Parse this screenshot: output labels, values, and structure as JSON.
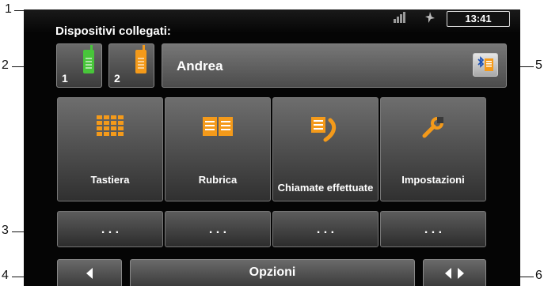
{
  "callouts": [
    "1",
    "2",
    "3",
    "4",
    "5",
    "6"
  ],
  "status": {
    "clock": "13:41",
    "signal_icon": "signal-icon",
    "gps_icon": "gps-satellite-icon"
  },
  "devices": {
    "label": "Dispositivi collegati:",
    "items": [
      {
        "number": "1",
        "icon": "phone-icon",
        "color": "#48c63a"
      },
      {
        "number": "2",
        "icon": "phone-icon",
        "color": "#f49a1a"
      }
    ]
  },
  "contact": {
    "name": "Andrea",
    "bluetooth_icon": "bluetooth-phonebook-icon"
  },
  "tiles": [
    {
      "label": "Tastiera",
      "icon": "keypad-icon"
    },
    {
      "label": "Rubrica",
      "icon": "phonebook-icon"
    },
    {
      "label": "Chiamate effettuate",
      "icon": "outgoing-calls-icon"
    },
    {
      "label": "Impostazioni",
      "icon": "wrench-icon"
    }
  ],
  "quick_slots": [
    ". . .",
    ". . .",
    ". . .",
    ". . ."
  ],
  "bottom": {
    "back_icon": "arrow-left-icon",
    "options_label": "Opzioni",
    "toggle_icon": "left-right-arrows-icon"
  },
  "accent": "#f49a1a"
}
